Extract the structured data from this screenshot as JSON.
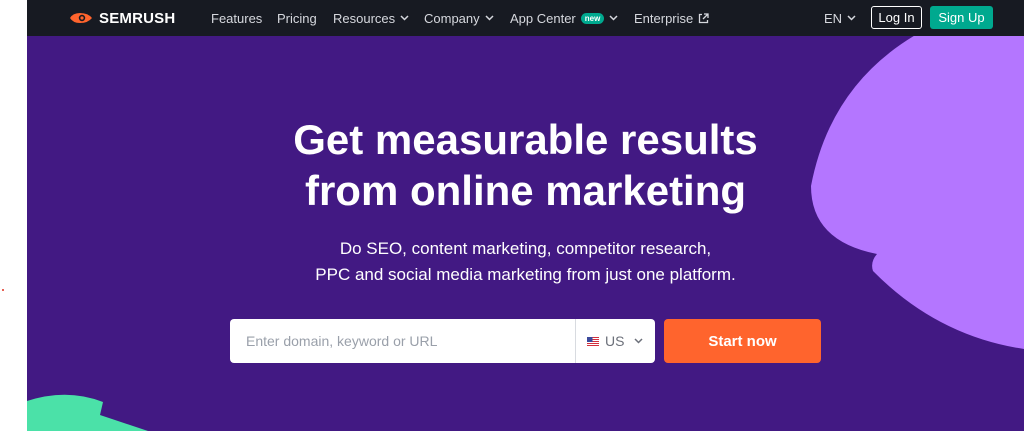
{
  "brand": {
    "name": "SEMRUSH",
    "logo_color": "#ff642d"
  },
  "nav": {
    "items": [
      {
        "label": "Features"
      },
      {
        "label": "Pricing"
      },
      {
        "label": "Resources"
      },
      {
        "label": "Company"
      },
      {
        "label": "App Center",
        "badge": "new"
      },
      {
        "label": "Enterprise"
      }
    ],
    "language": "EN",
    "login_label": "Log In",
    "signup_label": "Sign Up"
  },
  "hero": {
    "headline_line1": "Get measurable results",
    "headline_line2": "from online marketing",
    "subline_line1": "Do SEO, content marketing, competitor research,",
    "subline_line2": "PPC and social media marketing from just one platform.",
    "search": {
      "placeholder": "Enter domain, keyword or URL",
      "value": ""
    },
    "country": "US",
    "start_label": "Start now"
  },
  "colors": {
    "nav_bg": "#171a22",
    "hero_bg": "#421983",
    "accent_green": "#00a98f",
    "accent_orange": "#ff642d",
    "shape_violet": "#b476ff",
    "shape_mint": "#4be1a8"
  }
}
